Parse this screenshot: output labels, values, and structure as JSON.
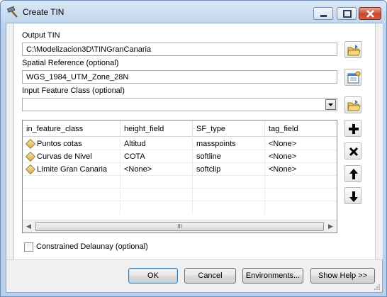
{
  "window": {
    "title": "Create TIN"
  },
  "output_tin": {
    "label": "Output TIN",
    "value": "C:\\Modelizacion3D\\TINGranCanaria"
  },
  "spatial_reference": {
    "label": "Spatial Reference (optional)",
    "value": "WGS_1984_UTM_Zone_28N"
  },
  "input_feature_class": {
    "label": "Input Feature Class (optional)",
    "value": ""
  },
  "table": {
    "columns": [
      "in_feature_class",
      "height_field",
      "SF_type",
      "tag_field"
    ],
    "rows": [
      {
        "in_feature_class": "Puntos cotas",
        "height_field": "Altitud",
        "SF_type": "masspoints",
        "tag_field": "<None>"
      },
      {
        "in_feature_class": "Curvas de Nivel",
        "height_field": "COTA",
        "SF_type": "softline",
        "tag_field": "<None>"
      },
      {
        "in_feature_class": "Límite Gran Canaria",
        "height_field": "<None>",
        "SF_type": "softclip",
        "tag_field": "<None>"
      }
    ],
    "scroll_thumb_label": "III"
  },
  "constrained_delaunay": {
    "label": "Constrained Delaunay (optional)",
    "checked": false
  },
  "buttons": {
    "ok": "OK",
    "cancel": "Cancel",
    "environments": "Environments...",
    "show_help": "Show Help >>"
  },
  "side_buttons": {
    "add": "plus-icon",
    "remove": "x-icon",
    "up": "arrow-up-icon",
    "down": "arrow-down-icon"
  },
  "colors": {
    "title_bar": "#c0d5ec",
    "close_button": "#c9462c",
    "default_button_border": "#3c7fb1"
  }
}
